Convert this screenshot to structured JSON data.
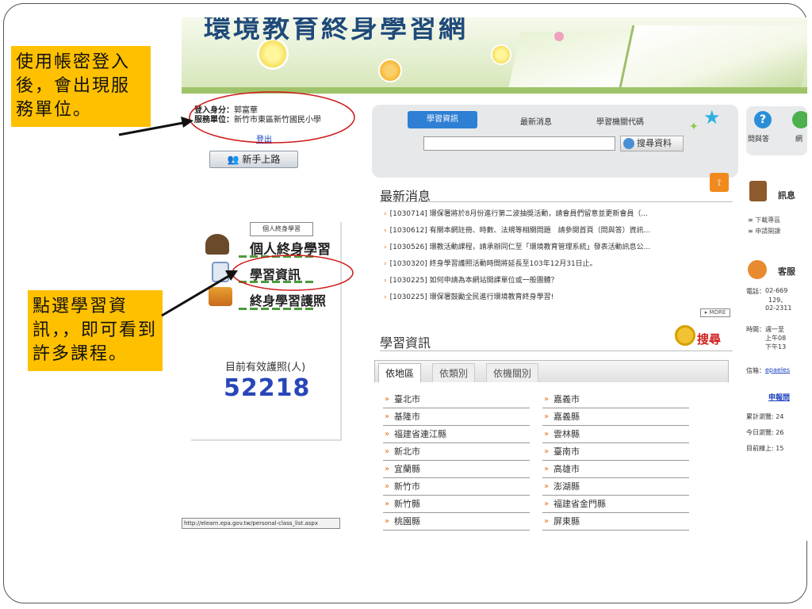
{
  "site": {
    "banner_title": "環境教育終身學習網"
  },
  "user": {
    "identity_label": "登入身分：",
    "identity_value": "郭富華",
    "unit_label": "服務單位：",
    "unit_value": "新竹市東區新竹國民小學",
    "logout": "登出",
    "new_user_button": "新手上路"
  },
  "left_menu": {
    "tag": "個人終身學習",
    "items": [
      "個人終身學習",
      "學習資訊",
      "終身學習護照"
    ],
    "license_label": "目前有效護照(人)",
    "license_count": "52218"
  },
  "status_bar": "http://elearn.epa.gov.tw/personal-class_list.aspx",
  "search": {
    "tabs": [
      "學習資訊",
      "最新消息",
      "學習機關代碼"
    ],
    "active_tab": "學習資訊",
    "input_value": "",
    "button": "搜尋資料"
  },
  "news": {
    "title": "最新消息",
    "items": [
      {
        "date": "[1030714]",
        "text": "環保署將於8月份進行第二波抽獎活動，請會員們留意並更新會員（..."
      },
      {
        "date": "[1030612]",
        "text": "有關本網註冊、時數、法規等相關問題　請參閱首頁（問與答）資訊..."
      },
      {
        "date": "[1030526]",
        "text": "環教活動課程，請承辦同仁至「環境教育管理系統」發表活動訊息公..."
      },
      {
        "date": "[1030320]",
        "text": "終身學習護照活動時間將延長至103年12月31日止。"
      },
      {
        "date": "[1030225]",
        "text": "如何申請為本網站開課單位或一般團體？"
      },
      {
        "date": "[1030225]",
        "text": "環保署鼓勵全民進行環境教育終身學習!"
      }
    ],
    "more": "▸ MORE"
  },
  "learning": {
    "title": "學習資訊",
    "search_link": "搜尋",
    "tabs": [
      "依地區",
      "依類別",
      "依機關別"
    ],
    "regions_left": [
      "臺北市",
      "基隆市",
      "福建省連江縣",
      "新北市",
      "宜蘭縣",
      "新竹市",
      "新竹縣",
      "桃園縣"
    ],
    "regions_right": [
      "嘉義市",
      "嘉義縣",
      "雲林縣",
      "臺南市",
      "高雄市",
      "澎湖縣",
      "福建省金門縣",
      "屏東縣"
    ]
  },
  "right_panel": {
    "faq": "問與答",
    "faq2": "網",
    "info_head": "訊息",
    "info_links": [
      "下載專區",
      "申請開課"
    ],
    "service_head": "客服",
    "phone_label": "電話：",
    "phone_lines": [
      "02-669",
      "129、",
      "02-2311"
    ],
    "time_label": "時間：",
    "time_lines": [
      "週一至",
      "上午08",
      "下午13"
    ],
    "mail_label": "信箱：",
    "mail_value": "epaeles",
    "report_link": "申報問",
    "stats": [
      "累計瀏覽: 24",
      "今日瀏覽: 26",
      "目前線上: 15"
    ]
  },
  "annotations": {
    "note1": "使用帳密登入後，會出現服務單位。",
    "note2": "點選學習資訊，，即可看到許多課程。"
  },
  "colors": {
    "note_bg": "#ffc000",
    "highlight_ring": "#d01818",
    "license_count": "#2846b8"
  }
}
